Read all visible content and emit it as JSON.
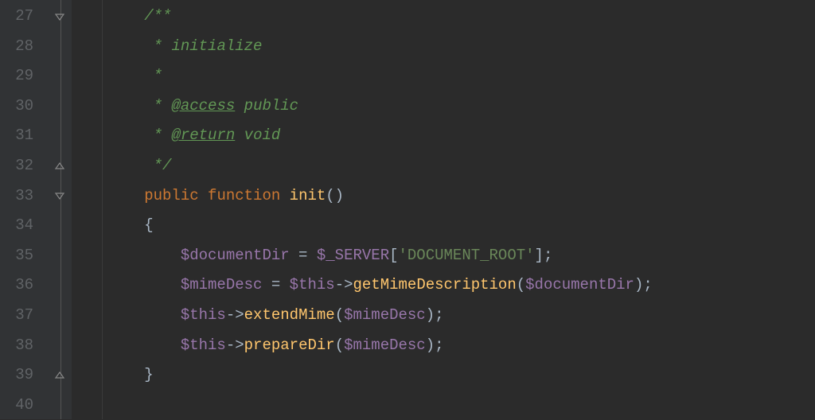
{
  "editor": {
    "lineNumbers": [
      "27",
      "28",
      "29",
      "30",
      "31",
      "32",
      "33",
      "34",
      "35",
      "36",
      "37",
      "38",
      "39",
      "40"
    ],
    "folds": {
      "0": "open-down",
      "5": "close-up",
      "6": "open-down",
      "12": "close-up"
    },
    "indentGuides": [
      38
    ],
    "code": {
      "l27": {
        "indent": "        ",
        "c1": "/**"
      },
      "l28": {
        "indent": "         ",
        "c1": "* ",
        "c2": "initialize"
      },
      "l29": {
        "indent": "         ",
        "c1": "*"
      },
      "l30": {
        "indent": "         ",
        "c1": "* ",
        "tag": "@access",
        "c2": " public"
      },
      "l31": {
        "indent": "         ",
        "c1": "* ",
        "tag": "@return",
        "c2": " void"
      },
      "l32": {
        "indent": "         ",
        "c1": "*/"
      },
      "l33": {
        "indent": "        ",
        "kw1": "public ",
        "kw2": "function ",
        "fn": "init",
        "p": "()"
      },
      "l34": {
        "indent": "        ",
        "b": "{"
      },
      "l35": {
        "indent": "            ",
        "v1": "$documentDir",
        "op": " = ",
        "v2": "$_SERVER",
        "br1": "[",
        "s": "'DOCUMENT_ROOT'",
        "br2": "]",
        ";": ";"
      },
      "l36": {
        "indent": "            ",
        "v1": "$mimeDesc",
        "op": " = ",
        "v2": "$this",
        "arrow": "->",
        "m": "getMimeDescription",
        "p1": "(",
        "v3": "$documentDir",
        "p2": ")",
        ";": ";"
      },
      "l37": {
        "indent": "            ",
        "v1": "$this",
        "arrow": "->",
        "m": "extendMime",
        "p1": "(",
        "v2": "$mimeDesc",
        "p2": ")",
        ";": ";"
      },
      "l38": {
        "indent": "            ",
        "v1": "$this",
        "arrow": "->",
        "m": "prepareDir",
        "p1": "(",
        "v2": "$mimeDesc",
        "p2": ")",
        ";": ";"
      },
      "l39": {
        "indent": "        ",
        "b": "}"
      }
    }
  }
}
